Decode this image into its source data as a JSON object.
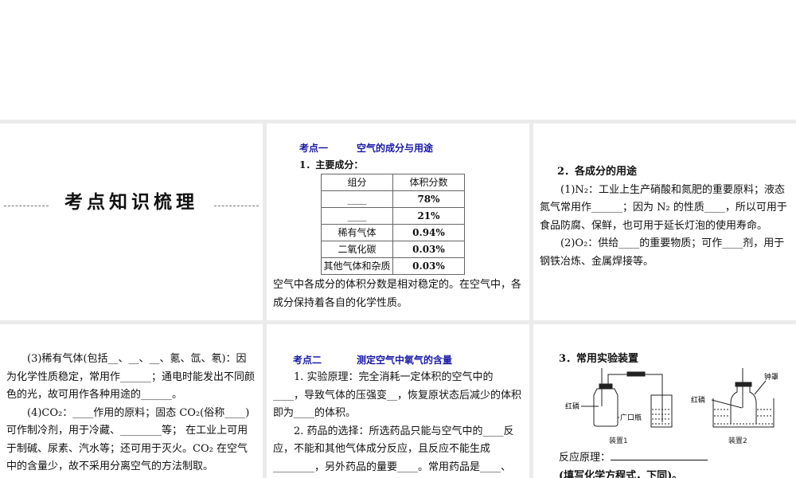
{
  "section_title": "考点知识梳理",
  "kp1": {
    "label": "考点一",
    "title": "空气的成分与用途",
    "item1": "1．主要成分：",
    "table": {
      "headers": [
        "组分",
        "体积分数"
      ],
      "rows": [
        [
          "____",
          "78%"
        ],
        [
          "____",
          "21%"
        ],
        [
          "稀有气体",
          "0.94%"
        ],
        [
          "二氧化碳",
          "0.03%"
        ],
        [
          "其他气体和杂质",
          "0.03%"
        ]
      ]
    },
    "note": "空气中各成分的体积分数是相对稳定的。在空气中，各成分保持着各自的化学性质。"
  },
  "uses": {
    "heading": "2．各成分的用途",
    "n2": "(1)N₂：工业上生产硝酸和氮肥的重要原料；液态氮气常用作______；因为 N₂ 的性质____，所以可用于食品防腐、保鲜，也可用于延长灯泡的使用寿命。",
    "o2": "(2)O₂：供给____的重要物质；可作____剂，用于钢铁冶炼、金属焊接等。",
    "rare": "(3)稀有气体(包括__、__、__、氪、氙、氡)：因为化学性质稳定，常用作______；通电时能发出不同颜色的光，故可用作各种用途的______。",
    "co2": "(4)CO₂：____作用的原料；固态 CO₂(俗称____)可作制冷剂，用于冷藏、________等； 在工业上可用于制碱、尿素、汽水等；还可用于灭火。CO₂ 在空气中的含量少，故不采用分离空气的方法制取。"
  },
  "kp2": {
    "label": "考点二",
    "title": "测定空气中氧气的含量",
    "p1": "1. 实验原理：完全消耗一定体积的空气中的____，导致气体的压强变__，恢复原状态后减少的体积即为____的体积。",
    "p2": "2. 药品的选择：所选药品只能与空气中的____反应，不能和其他气体成分反应，且反应不能生成________，另外药品的量要____。常用药品是____、____"
  },
  "apparatus": {
    "heading": "3．常用实验装置",
    "red_p": "红磷",
    "bottle": "广口瓶",
    "bell": "钟罩",
    "cap1": "装置1",
    "cap2": "装置2",
    "reaction": "反应原理：",
    "note": "(填写化学方程式，下同)。"
  }
}
